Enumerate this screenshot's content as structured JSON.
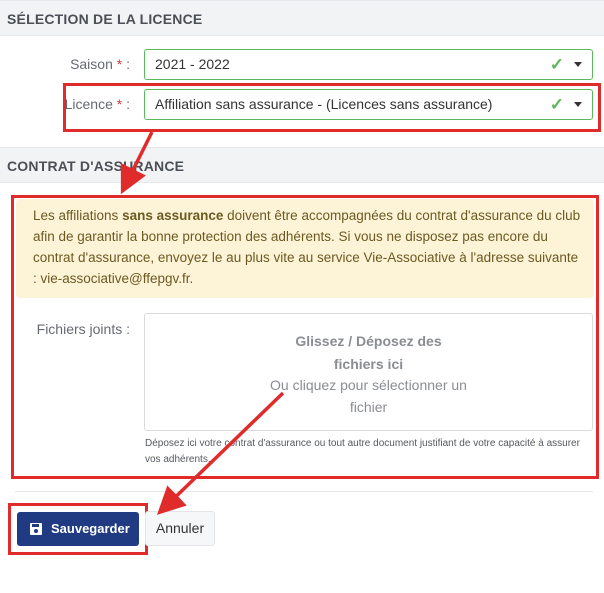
{
  "sections": {
    "licence_title": "SÉLECTION DE LA LICENCE",
    "contrat_title": "CONTRAT D'ASSURANCE"
  },
  "saison": {
    "label": "Saison",
    "required_mark": "*",
    "colon": ":",
    "value": "2021 - 2022"
  },
  "licence": {
    "label": "Licence",
    "required_mark": "*",
    "colon": ":",
    "value": "Affiliation sans assurance - (Licences sans assurance)"
  },
  "alert": {
    "text_before": "Les affiliations ",
    "text_bold": "sans assurance",
    "text_after": " doivent être accompagnées du contrat d'assurance du club afin de garantir la bonne protection des adhérents. Si vous ne disposez pas encore du contrat d'assurance, envoyez le au plus vite au service Vie-Associative à l'adresse suivante : vie-associative@ffepgv.fr."
  },
  "files": {
    "label": "Fichiers joints :",
    "drop_title_line1": "Glissez / Déposez des",
    "drop_title_line2": "fichiers ici",
    "drop_sub_line1": "Ou cliquez pour sélectionner un",
    "drop_sub_line2": "fichier",
    "help": "Déposez ici votre contrat d'assurance ou tout autre document justifiant de votre capacité à assurer vos adhérents."
  },
  "buttons": {
    "save": "Sauvegarder",
    "cancel": "Annuler"
  },
  "icons": {
    "valid": "check-icon",
    "dropdown": "caret-down-icon",
    "save": "floppy-disk-icon"
  },
  "colors": {
    "primary": "#213b82",
    "valid": "#5cb85c",
    "highlight": "#e02b2b",
    "alert_bg": "#fdf3d6"
  }
}
